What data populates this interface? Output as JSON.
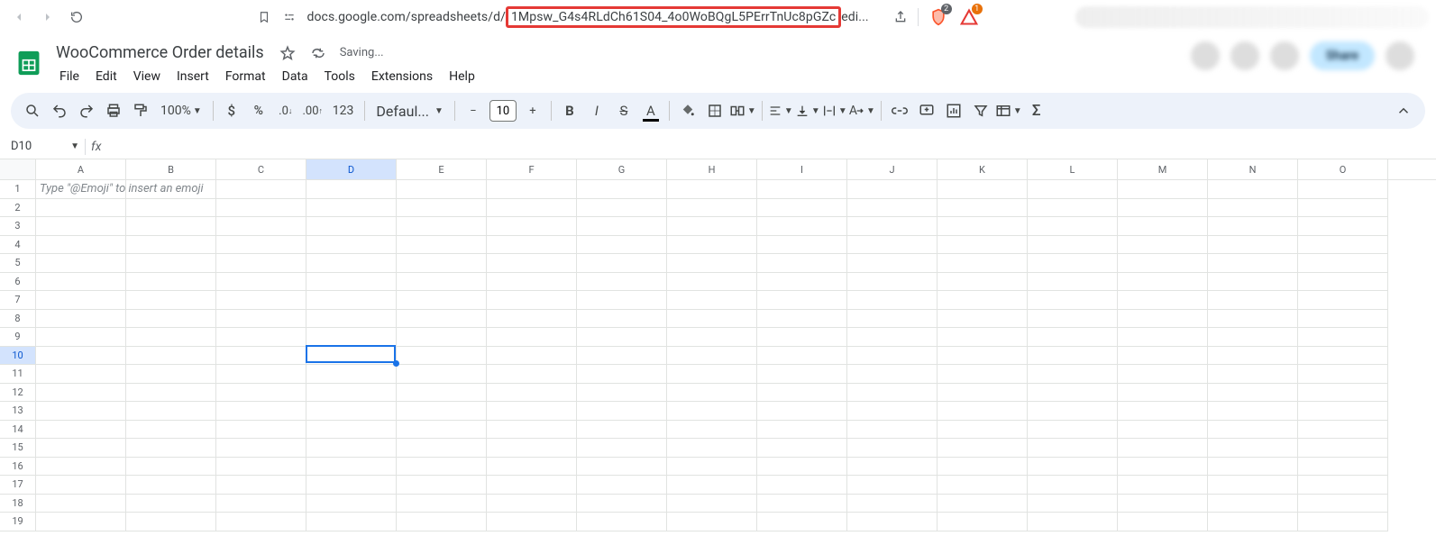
{
  "browser": {
    "url_prefix": "docs.google.com/spreadsheets/d/",
    "url_highlighted": "1Mpsw_G4s4RLdCh61S04_4o0WoBQgL5PErrTnUc8pGZc",
    "url_suffix": "edi...",
    "badge1_count": "2",
    "badge2_count": "1"
  },
  "doc": {
    "title": "WooCommerce Order details",
    "saving": "Saving...",
    "share": "Share"
  },
  "menu": [
    "File",
    "Edit",
    "View",
    "Insert",
    "Format",
    "Data",
    "Tools",
    "Extensions",
    "Help"
  ],
  "toolbar": {
    "zoom": "100%",
    "font": "Defaul...",
    "font_size": "10",
    "format_123": "123"
  },
  "namebox": {
    "cell": "D10"
  },
  "grid": {
    "columns": [
      "A",
      "B",
      "C",
      "D",
      "E",
      "F",
      "G",
      "H",
      "I",
      "J",
      "K",
      "L",
      "M",
      "N",
      "O"
    ],
    "row_count": 19,
    "hint_cell": {
      "row": 1,
      "col": "A",
      "text": "Type \"@Emoji\" to insert an emoji"
    },
    "selected": {
      "row": 10,
      "col": "D"
    }
  }
}
